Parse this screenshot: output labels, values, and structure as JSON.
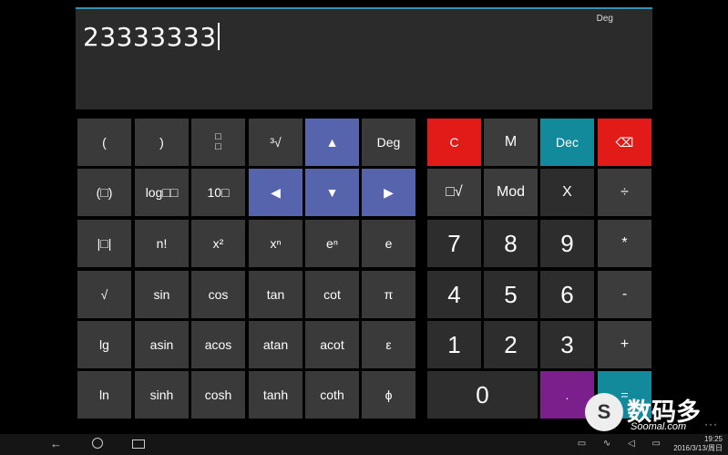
{
  "display": {
    "mode": "Deg",
    "value": "23333333"
  },
  "keys": {
    "lparen": "(",
    "rparen": ")",
    "fraction": "□\n□",
    "cbrt": "³√",
    "up": "▲",
    "deg": "Deg",
    "clear": "C",
    "memory": "M",
    "dec": "Dec",
    "backspace": "⌫",
    "paren_box": "(□)",
    "log_base": "log□□",
    "pow10": "10□",
    "left": "◀",
    "down": "▼",
    "right": "▶",
    "nroot": "□√",
    "mod": "Mod",
    "times_x": "X",
    "divide": "÷",
    "abs": "|□|",
    "fact": "n!",
    "square": "x²",
    "pow": "xⁿ",
    "exp": "eⁿ",
    "e": "e",
    "seven": "7",
    "eight": "8",
    "nine": "9",
    "multiply": "*",
    "sqrt": "√",
    "sin": "sin",
    "cos": "cos",
    "tan": "tan",
    "cot": "cot",
    "pi": "π",
    "four": "4",
    "five": "5",
    "six": "6",
    "minus": "-",
    "lg": "lg",
    "asin": "asin",
    "acos": "acos",
    "atan": "atan",
    "acot": "acot",
    "epsilon": "ε",
    "one": "1",
    "two": "2",
    "three": "3",
    "plus": "+",
    "ln": "ln",
    "sinh": "sinh",
    "cosh": "cosh",
    "tanh": "tanh",
    "coth": "coth",
    "phi": "ϕ",
    "zero": "0",
    "dot": ".",
    "equals": "="
  },
  "colors": {
    "red": "#e21a18",
    "teal": "#128a9c",
    "arrow": "#5564ad",
    "purple": "#7a1f8c"
  },
  "taskbar": {
    "back_icon": "back-arrow-icon",
    "home_icon": "home-icon",
    "task_icon": "task-view-icon",
    "time": "19:25",
    "date": "2016/3/13/周日"
  },
  "watermark": {
    "cn": "数码多",
    "en": "Soomal.com"
  },
  "more": "···"
}
